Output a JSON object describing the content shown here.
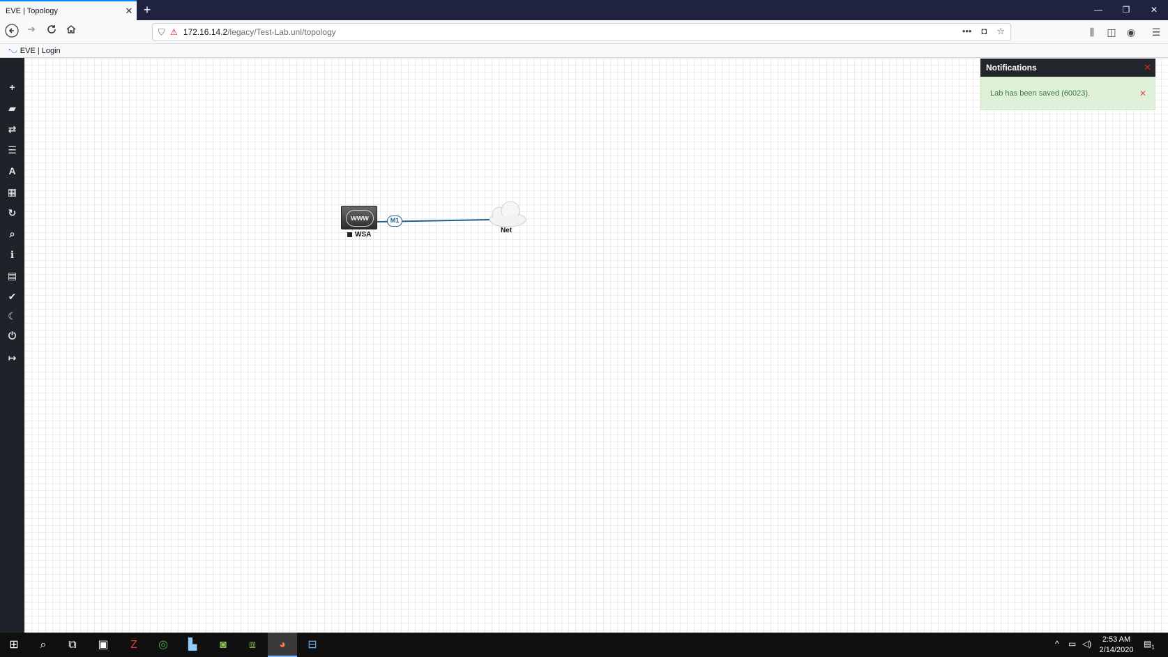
{
  "browser": {
    "tab_title": "EVE | Topology",
    "tab_close": "✕",
    "new_tab": "+",
    "url_host": "172.16.14.2",
    "url_path": "/legacy/Test-Lab.unl/topology",
    "bookmark": "EVE | Login",
    "window_controls": {
      "minimize": "—",
      "restore": "❐",
      "close": "✕"
    },
    "nav_icons": {
      "back": "back-arrow-icon",
      "forward": "forward-arrow-icon",
      "reload": "reload-icon",
      "home": "home-icon"
    }
  },
  "sidebar": {
    "items": [
      {
        "icon": "plus-icon",
        "glyph": "+"
      },
      {
        "icon": "nodes-icon",
        "glyph": "▰"
      },
      {
        "icon": "networks-icon",
        "glyph": "⇄"
      },
      {
        "icon": "startup-configs-icon",
        "glyph": "☰"
      },
      {
        "icon": "pictures-icon",
        "glyph": "A"
      },
      {
        "icon": "config-objects-icon",
        "glyph": "▦"
      },
      {
        "icon": "refresh-icon",
        "glyph": "↻"
      },
      {
        "icon": "zoom-icon",
        "glyph": "⌕"
      },
      {
        "icon": "info-icon",
        "glyph": "ℹ"
      },
      {
        "icon": "lab-details-icon",
        "glyph": "▤"
      },
      {
        "icon": "lock-lab-icon",
        "glyph": "✔"
      },
      {
        "icon": "dark-mode-icon",
        "glyph": "☾"
      },
      {
        "icon": "power-icon",
        "glyph": "⏻"
      },
      {
        "icon": "close-lab-icon",
        "glyph": "↦"
      }
    ]
  },
  "topology": {
    "nodes": [
      {
        "name": "WSA",
        "icon_text": "www"
      },
      {
        "name": "Net"
      }
    ],
    "link_label": "M1",
    "link_color": "#1f5f8a"
  },
  "notifications": {
    "title": "Notifications",
    "close": "✕",
    "message": "Lab has been saved (60023).",
    "message_close": "✕"
  },
  "taskbar": {
    "time": "2:53 AM",
    "date": "2/14/2020",
    "notification_count": "1"
  }
}
